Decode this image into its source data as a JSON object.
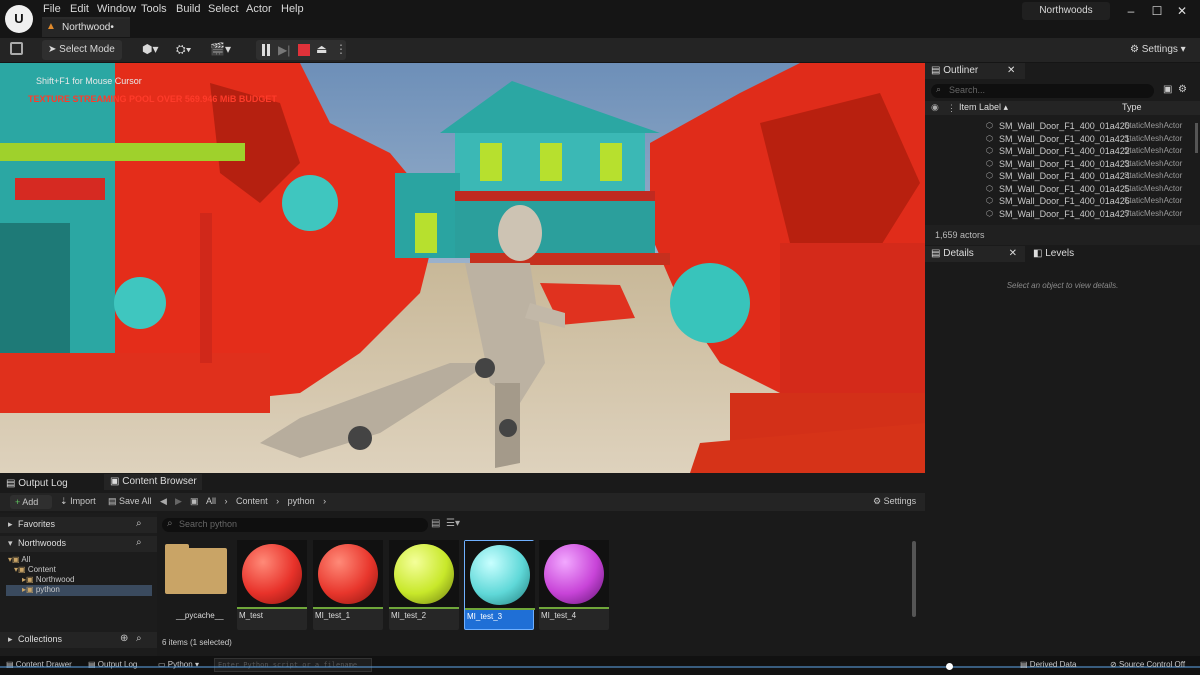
{
  "menubar": {
    "items": [
      "File",
      "Edit",
      "Window",
      "Tools",
      "Build",
      "Select",
      "Actor",
      "Help"
    ],
    "doc_tab": "Northwood•",
    "project": "Northwoods"
  },
  "toolbar": {
    "mode": "Select Mode",
    "settings": "Settings"
  },
  "viewport": {
    "hint": "Shift+F1 for Mouse Cursor",
    "warning": "TEXTURE STREAMING POOL OVER 569.946 MiB BUDGET"
  },
  "outliner": {
    "tab": "Outliner",
    "search_placeholder": "Search...",
    "col_label": "Item Label ▴",
    "col_type": "Type",
    "rows": [
      {
        "label": "SM_Wall_Door_F1_400_01a420",
        "type": "StaticMeshActor"
      },
      {
        "label": "SM_Wall_Door_F1_400_01a421",
        "type": "StaticMeshActor"
      },
      {
        "label": "SM_Wall_Door_F1_400_01a422",
        "type": "StaticMeshActor"
      },
      {
        "label": "SM_Wall_Door_F1_400_01a423",
        "type": "StaticMeshActor"
      },
      {
        "label": "SM_Wall_Door_F1_400_01a424",
        "type": "StaticMeshActor"
      },
      {
        "label": "SM_Wall_Door_F1_400_01a425",
        "type": "StaticMeshActor"
      },
      {
        "label": "SM_Wall_Door_F1_400_01a426",
        "type": "StaticMeshActor"
      },
      {
        "label": "SM_Wall_Door_F1_400_01a427",
        "type": "StaticMeshActor"
      }
    ],
    "count": "1,659 actors"
  },
  "details": {
    "tab": "Details",
    "tab2": "Levels",
    "empty": "Select an object to view details."
  },
  "bottom": {
    "tab1": "Output Log",
    "tab2": "Content Browser",
    "add": "Add",
    "import": "Import",
    "save_all": "Save All",
    "path": [
      "All",
      "Content",
      "python"
    ],
    "settings": "Settings",
    "favorites": "Favorites",
    "project": "Northwoods",
    "tree": [
      "All",
      "Content",
      "Northwood",
      "python"
    ],
    "collections": "Collections",
    "search_placeholder": "Search python",
    "assets": [
      {
        "name": "__pycache__",
        "kind": "folder"
      },
      {
        "name": "M_test",
        "color": "#e8322a"
      },
      {
        "name": "MI_test_1",
        "color": "#e8362c"
      },
      {
        "name": "MI_test_2",
        "color": "#c8e82a"
      },
      {
        "name": "MI_test_3",
        "color": "#5fd8d8"
      },
      {
        "name": "MI_test_4",
        "color": "#c844d8"
      }
    ],
    "items_count": "6 items (1 selected)"
  },
  "status": {
    "drawer": "Content Drawer",
    "output": "Output Log",
    "python": "Python",
    "cmd_placeholder": "Enter Python script or a filename",
    "derived": "Derived Data",
    "source_control": "Source Control Off"
  }
}
